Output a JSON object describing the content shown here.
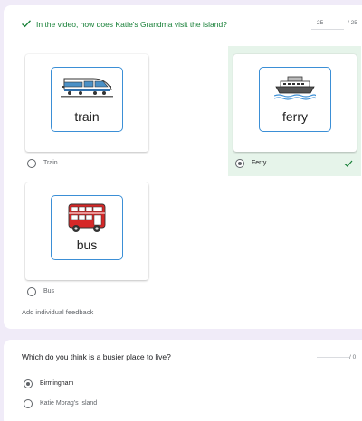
{
  "question1": {
    "title": "In the video, how does Katie's Grandma visit the island?",
    "score": "25",
    "total": "/ 25",
    "options": [
      {
        "label": "Train",
        "symbol_word": "train",
        "selected": false,
        "correct": false
      },
      {
        "label": "Ferry",
        "symbol_word": "ferry",
        "selected": true,
        "correct": true
      },
      {
        "label": "Bus",
        "symbol_word": "bus",
        "selected": false,
        "correct": false
      }
    ],
    "feedback_link": "Add individual feedback"
  },
  "question2": {
    "title": "Which do you think is a busier place to live?",
    "score": "",
    "total": "/ 0",
    "options": [
      {
        "label": "Birmingham",
        "selected": true
      },
      {
        "label": "Katie Morag's Island",
        "selected": false
      }
    ]
  },
  "colors": {
    "background": "#f0ebf8",
    "correct_green": "#188038",
    "correct_highlight": "#e6f4ea",
    "symbol_border": "#3b8fd6",
    "bus_red": "#d62828"
  },
  "icons": [
    "check-icon",
    "train-symbol",
    "ferry-symbol",
    "bus-symbol",
    "radio-icon"
  ]
}
